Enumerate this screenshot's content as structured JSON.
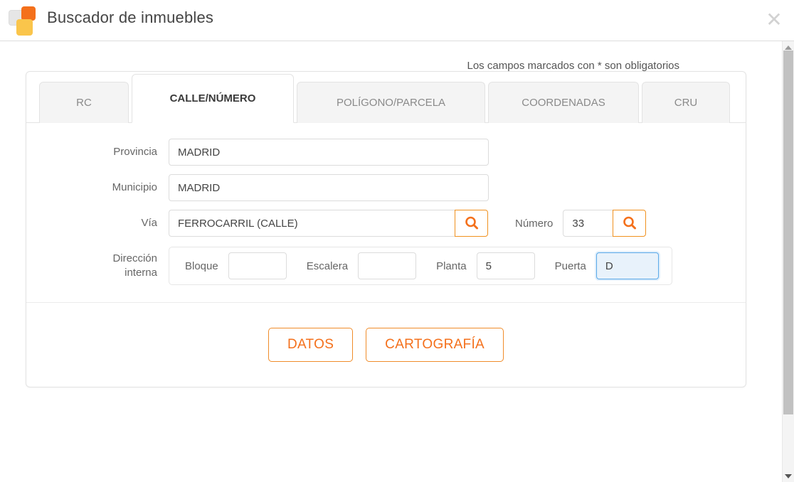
{
  "header": {
    "title": "Buscador de inmuebles",
    "close_label": "✕",
    "logo_name": "catastro-logo"
  },
  "note": {
    "required_fields": "Los campos marcados con * son obligatorios"
  },
  "tabs": [
    {
      "label": "RC",
      "active": false
    },
    {
      "label": "CALLE/NÚMERO",
      "active": true
    },
    {
      "label": "POLÍGONO/PARCELA",
      "active": false
    },
    {
      "label": "COORDENADAS",
      "active": false
    },
    {
      "label": "CRU",
      "active": false
    }
  ],
  "form": {
    "provincia": {
      "label": "Provincia",
      "value": "MADRID",
      "placeholder": ""
    },
    "municipio": {
      "label": "Municipio",
      "value": "MADRID",
      "placeholder": ""
    },
    "via": {
      "label": "Vía",
      "value": "FERROCARRIL (CALLE)",
      "placeholder": "",
      "search_icon": "search-icon"
    },
    "numero": {
      "label": "Número",
      "value": "33",
      "placeholder": "",
      "search_icon": "search-icon"
    },
    "direccion_interna": {
      "label_line1": "Dirección",
      "label_line2": "interna",
      "bloque": {
        "label": "Bloque",
        "value": "",
        "placeholder": ""
      },
      "escalera": {
        "label": "Escalera",
        "value": "",
        "placeholder": ""
      },
      "planta": {
        "label": "Planta",
        "value": "5",
        "placeholder": ""
      },
      "puerta": {
        "label": "Puerta",
        "value": "D",
        "placeholder": "",
        "focused": true
      }
    }
  },
  "actions": {
    "datos": "DATOS",
    "cartografia": "CARTOGRAFÍA"
  },
  "scrollbar": {
    "up_arrow": "scroll-up-arrow",
    "down_arrow": "scroll-down-arrow"
  },
  "colors": {
    "accent_orange": "#f4701b",
    "accent_yellow": "#fac54b",
    "focus_blue": "#5aa9e8",
    "border_gray": "#e3e3e3"
  }
}
